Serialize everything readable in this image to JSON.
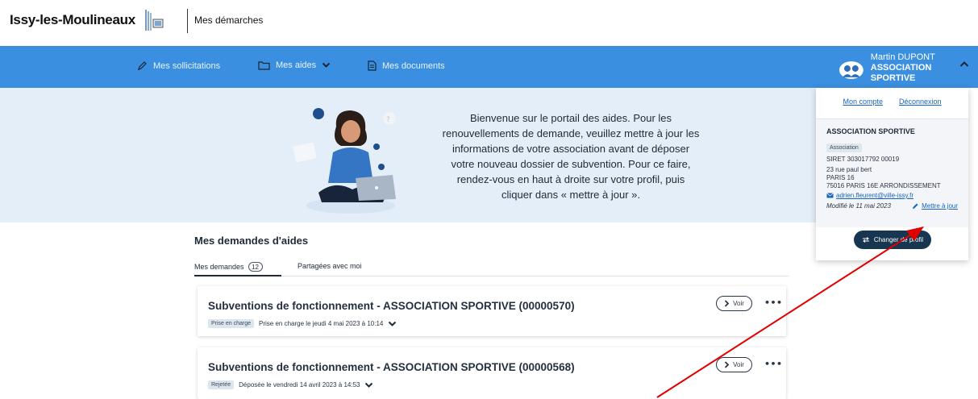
{
  "header": {
    "city_name": "Issy-les-Moulineaux",
    "app_name": "Mes démarches"
  },
  "nav": {
    "items": [
      {
        "label": "Mes sollicitations",
        "icon": "pencil-icon"
      },
      {
        "label": "Mes aides",
        "icon": "folder-icon"
      },
      {
        "label": "Mes documents",
        "icon": "document-icon"
      }
    ],
    "user_name": "Martin DUPONT",
    "user_org": "ASSOCIATION SPORTIVE"
  },
  "banner": {
    "text": "Bienvenue sur le portail des aides. Pour les renouvellements de demande, veuillez mettre à jour les informations de votre association avant de déposer votre nouveau dossier de subvention. Pour ce faire, rendez-vous en haut à droite sur votre profil, puis cliquer dans « mettre à jour »."
  },
  "profile": {
    "account_link": "Mon compte",
    "logout_link": "Déconnexion",
    "org_name": "ASSOCIATION SPORTIVE",
    "org_type": "Association",
    "siret": "SIRET 303017792 00019",
    "address_line1": "23 rue paul bert",
    "address_line2": "PARIS 16",
    "address_line3": "75016 PARIS 16E ARRONDISSEMENT",
    "email": "adrien.fleurent@ville-issy.fr",
    "modified": "Modifié le 11 mai 2023",
    "update_link": "Mettre à jour",
    "change_profile": "Changer de profil"
  },
  "demandes": {
    "title": "Mes demandes d'aides",
    "tab_mine": "Mes demandes",
    "tab_mine_count": "12",
    "tab_shared": "Partagées avec moi",
    "cards": [
      {
        "title": "Subventions de fonctionnement - ASSOCIATION SPORTIVE (00000570)",
        "status": "Prise en charge",
        "status_detail": "Prise en charge le jeudi 4 mai 2023 à 10:14",
        "voir": "Voir"
      },
      {
        "title": "Subventions de fonctionnement - ASSOCIATION SPORTIVE (00000568)",
        "status": "Rejetée",
        "status_detail": "Déposée le vendredi 14 avril 2023 à 14:53",
        "voir": "Voir"
      }
    ]
  },
  "colors": {
    "nav_blue": "#3a8fe0",
    "banner_bg": "#e3eef9",
    "dark_button": "#173650",
    "link_blue": "#1565c0",
    "annotation_arrow": "#e00000"
  }
}
